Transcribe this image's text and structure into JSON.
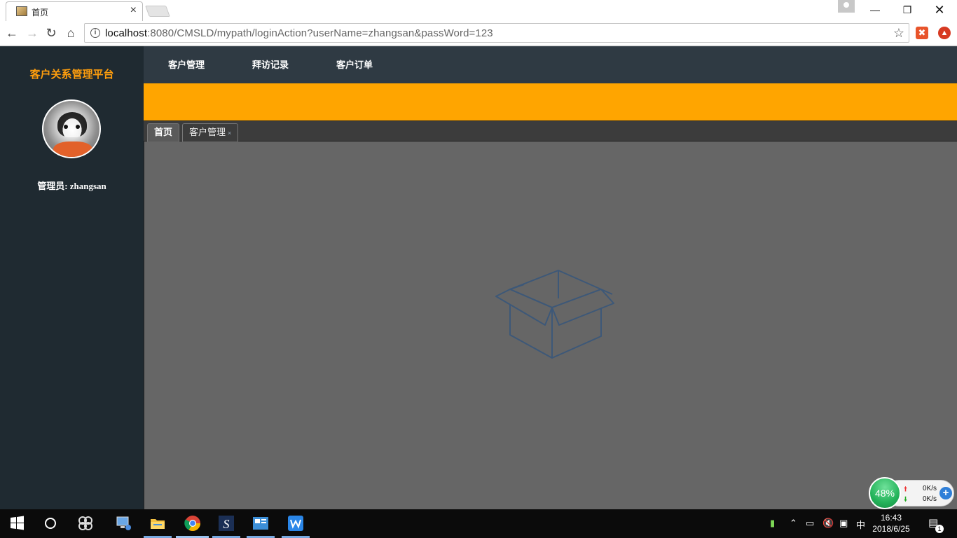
{
  "browser": {
    "tab_title": "首页",
    "tab_close": "×",
    "url_host": "localhost",
    "url_rest": ":8080/CMSLD/mypath/loginAction?userName=zhangsan&passWord=123",
    "icons": [
      "back-icon",
      "forward-icon",
      "reload-icon",
      "home-icon",
      "info-icon",
      "star-icon"
    ]
  },
  "sidebar": {
    "brand": "客户关系管理平台",
    "admin_label": "管理员: zhangsan"
  },
  "topnav": {
    "items": [
      "客户管理",
      "拜访记录",
      "客户订单"
    ]
  },
  "tabs": {
    "items": [
      {
        "label": "首页",
        "active": true
      },
      {
        "label": "客户管理",
        "active": false,
        "close": "×"
      }
    ]
  },
  "meter": {
    "percent": "48%",
    "up": "0K/s",
    "down": "0K/s"
  },
  "taskbar": {
    "time": "16:43",
    "date": "2018/6/25",
    "ime": "中",
    "notifications": "1"
  },
  "colors": {
    "brand": "#ff9e0d",
    "banner": "#ffa500",
    "sidebar": "#1f2a31",
    "topnav": "#2f3a43"
  }
}
